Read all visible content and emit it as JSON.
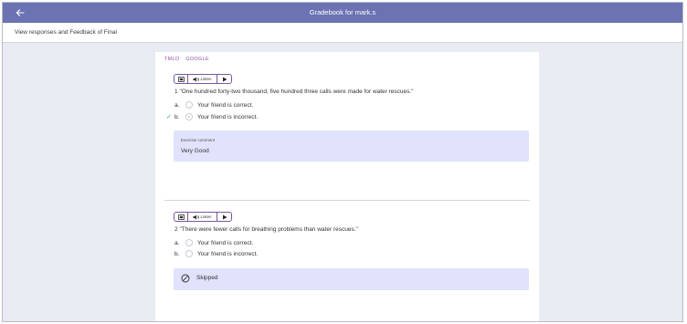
{
  "header": {
    "title": "Gradebook for mark.s",
    "back_icon": "arrow-left-icon"
  },
  "subheader": {
    "text": "View responses and Feedback of Final"
  },
  "tags": [
    "TMLO",
    "GOOGLE"
  ],
  "colors": {
    "header": "#6b73b3",
    "tag": "#8a53a6",
    "check": "#3aa55e",
    "feedback_box": "#e1e2fb"
  },
  "tts": {
    "listen_label": "Listen"
  },
  "questions": [
    {
      "number": "1",
      "text": "\"One hundred forty-two thousand, five hundred three calls were made for water rescues.\"",
      "options": [
        {
          "letter": "a.",
          "text": "Your friend is correct.",
          "selected": false,
          "correct": false
        },
        {
          "letter": "b.",
          "text": "Your friend is incorrect.",
          "selected": true,
          "correct": true
        }
      ],
      "comment": {
        "label": "Exercise comment",
        "text": "Very Good"
      }
    },
    {
      "number": "2",
      "text": "\"There were fewer calls for breathing problems than water rescues.\"",
      "options": [
        {
          "letter": "a.",
          "text": "Your friend is correct.",
          "selected": false
        },
        {
          "letter": "b.",
          "text": "Your friend is incorrect.",
          "selected": false
        }
      ],
      "status": "Skipped"
    }
  ]
}
